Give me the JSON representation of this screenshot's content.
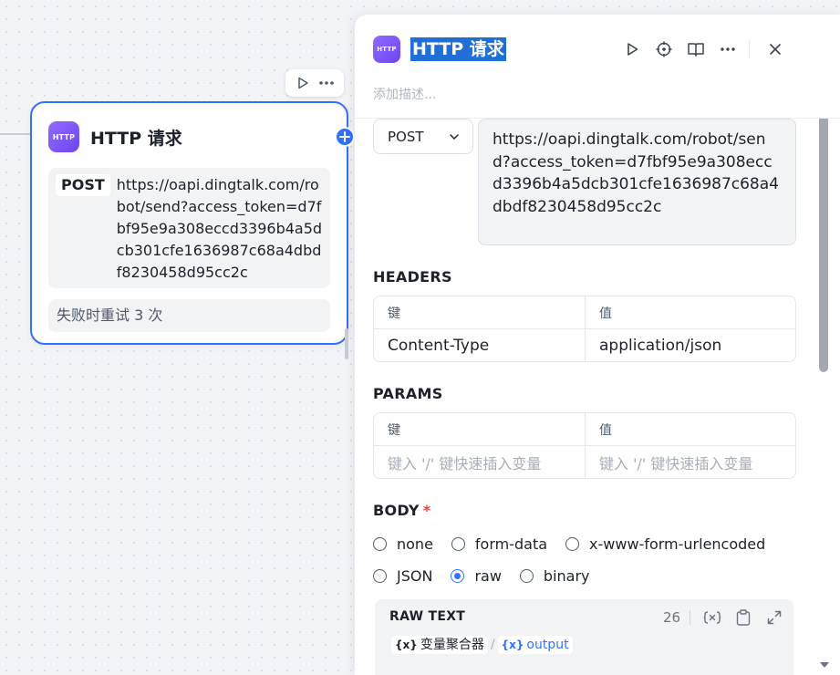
{
  "node": {
    "icon_text": "HTTP",
    "title": "HTTP 请求",
    "method": "POST",
    "url": "https://oapi.dingtalk.com/robot/send?access_token=d7fbf95e9a308eccd3396b4a5dcb301cfe1636987c68a4dbdf8230458d95cc2c",
    "retry": "失败时重试 3 次"
  },
  "panel": {
    "icon_text": "HTTP",
    "title": "HTTP 请求",
    "description_placeholder": "添加描述...",
    "method": "POST",
    "url": "https://oapi.dingtalk.com/robot/send?access_token=d7fbf95e9a308eccd3396b4a5dcb301cfe1636987c68a4dbdf8230458d95cc2c",
    "headers": {
      "label": "HEADERS",
      "col_key": "键",
      "col_value": "值",
      "row": {
        "key": "Content-Type",
        "value": "application/json"
      }
    },
    "params": {
      "label": "PARAMS",
      "col_key": "键",
      "col_value": "值",
      "key_placeholder": "键入 '/' 键快速插入变量",
      "value_placeholder": "键入 '/' 键快速插入变量"
    },
    "body": {
      "label": "BODY",
      "required_mark": "*",
      "options_row1": [
        "none",
        "form-data",
        "x-www-form-urlencoded"
      ],
      "options_row2": [
        "JSON",
        "raw",
        "binary"
      ],
      "selected": "raw",
      "raw": {
        "title": "RAW TEXT",
        "count": "26",
        "var_node": "变量聚合器",
        "var_separator": "/",
        "var_output": "output",
        "brace_glyph": "{x}"
      }
    }
  },
  "colors": {
    "accent": "#3370ff",
    "http_icon": "#7b55f5",
    "required": "#f53f3f"
  }
}
